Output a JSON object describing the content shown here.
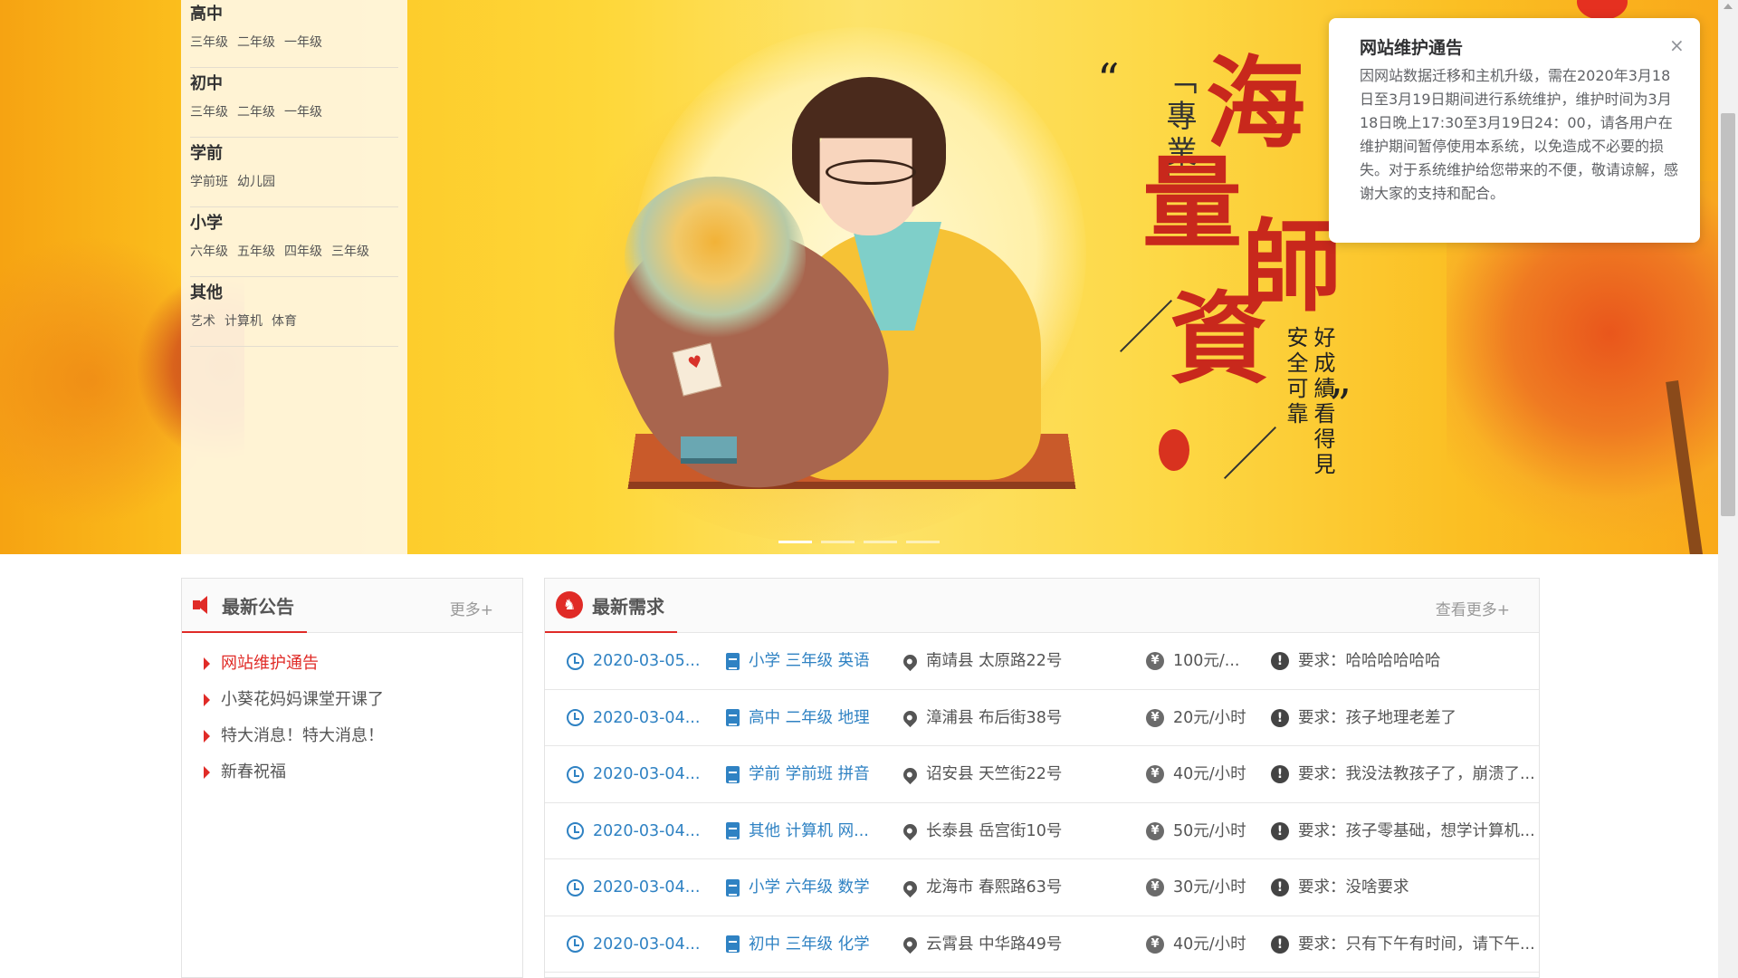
{
  "categories": [
    {
      "title": "高中",
      "items": [
        "三年级",
        "二年级",
        "一年级"
      ]
    },
    {
      "title": "初中",
      "items": [
        "三年级",
        "二年级",
        "一年级"
      ]
    },
    {
      "title": "学前",
      "items": [
        "学前班",
        "幼儿园"
      ]
    },
    {
      "title": "小学",
      "items": [
        "六年级",
        "五年级",
        "四年级",
        "三年级"
      ]
    },
    {
      "title": "其他",
      "items": [
        "艺术",
        "计算机",
        "体育"
      ]
    }
  ],
  "banner": {
    "quote_open": "“",
    "quote_close": "”",
    "zhuanye": "「專業」",
    "big_chars": [
      "海",
      "量",
      "師",
      "資"
    ],
    "slogan_a": "好成績看得見",
    "slogan_b": "安全可靠",
    "tag_heart": "♥",
    "slides": 4,
    "active_slide": 0
  },
  "popup": {
    "title": "网站维护通告",
    "body": "因网站数据迁移和主机升级，需在2020年3月18日至3月19日期间进行系统维护，维护时间为3月18日晚上17:30至3月19日24：00，请各用户在维护期间暂停使用本系统，以免造成不必要的损失。对于系统维护给您带来的不便，敬请谅解，感谢大家的支持和配合。",
    "close": "×"
  },
  "notice": {
    "title": "最新公告",
    "more": "更多+",
    "items": [
      "网站维护通告",
      "小葵花妈妈课堂开课了",
      "特大消息！特大消息！",
      "新春祝福"
    ]
  },
  "demand": {
    "title": "最新需求",
    "more": "查看更多+",
    "icon_char": "♞",
    "rows": [
      {
        "date": "2020-03-05...",
        "subject": "小学 三年级 英语",
        "address": "南靖县 太原路22号",
        "price": "100元/...",
        "req": "要求：哈哈哈哈哈哈"
      },
      {
        "date": "2020-03-04...",
        "subject": "高中 二年级 地理",
        "address": "漳浦县 布后街38号",
        "price": "20元/小时",
        "req": "要求：孩子地理老差了"
      },
      {
        "date": "2020-03-04...",
        "subject": "学前 学前班 拼音",
        "address": "诏安县 天竺街22号",
        "price": "40元/小时",
        "req": "要求：我没法教孩子了，崩溃了..."
      },
      {
        "date": "2020-03-04...",
        "subject": "其他 计算机 网...",
        "address": "长泰县 岳宫街10号",
        "price": "50元/小时",
        "req": "要求：孩子零基础，想学计算机..."
      },
      {
        "date": "2020-03-04...",
        "subject": "小学 六年级 数学",
        "address": "龙海市 春熙路63号",
        "price": "30元/小时",
        "req": "要求：没啥要求"
      },
      {
        "date": "2020-03-04...",
        "subject": "初中 三年级 化学",
        "address": "云霄县 中华路49号",
        "price": "40元/小时",
        "req": "要求：只有下午有时间，请下午..."
      }
    ]
  },
  "icons": {
    "yen": "¥",
    "alert": "!"
  }
}
